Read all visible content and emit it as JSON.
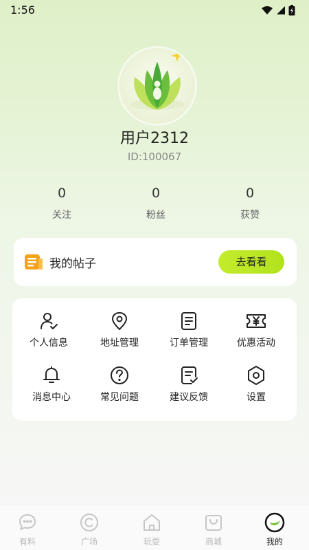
{
  "status": {
    "time": "1:56"
  },
  "profile": {
    "username": "用户2312",
    "user_id": "ID:100067"
  },
  "stats": [
    {
      "value": "0",
      "label": "关注"
    },
    {
      "value": "0",
      "label": "粉丝"
    },
    {
      "value": "0",
      "label": "获赞"
    }
  ],
  "posts_card": {
    "title": "我的帖子",
    "button": "去看看"
  },
  "menu": [
    {
      "label": "个人信息",
      "icon": "person-check-icon"
    },
    {
      "label": "地址管理",
      "icon": "location-pin-icon"
    },
    {
      "label": "订单管理",
      "icon": "document-icon"
    },
    {
      "label": "优惠活动",
      "icon": "coupon-yen-icon"
    },
    {
      "label": "消息中心",
      "icon": "bell-icon"
    },
    {
      "label": "常见问题",
      "icon": "question-circle-icon"
    },
    {
      "label": "建议反馈",
      "icon": "feedback-document-icon"
    },
    {
      "label": "设置",
      "icon": "hexagon-settings-icon"
    }
  ],
  "tabs": [
    {
      "label": "有料",
      "icon": "chat-bubble-icon"
    },
    {
      "label": "广场",
      "icon": "plaza-circle-icon"
    },
    {
      "label": "玩耍",
      "icon": "home-icon"
    },
    {
      "label": "商城",
      "icon": "shopping-bag-icon"
    },
    {
      "label": "我的",
      "icon": "profile-leaf-icon",
      "active": true
    }
  ],
  "colors": {
    "accent": "#b8e624",
    "active_tab": "#222222",
    "inactive_tab": "#b8b8b8"
  }
}
